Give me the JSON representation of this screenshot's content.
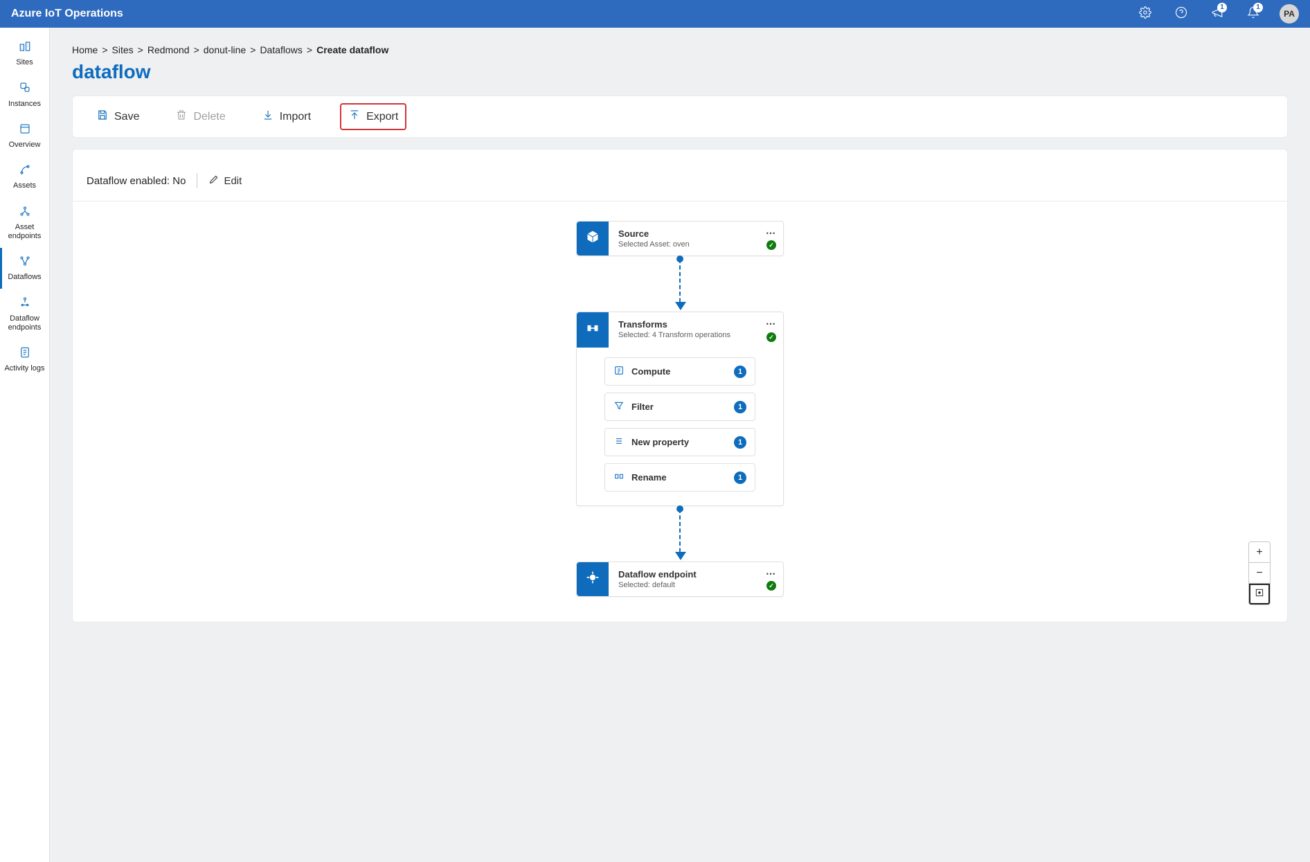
{
  "header": {
    "product_name": "Azure IoT Operations",
    "feedback_badge": "1",
    "bell_badge": "1",
    "avatar_initials": "PA"
  },
  "sidebar": {
    "items": [
      {
        "label": "Sites"
      },
      {
        "label": "Instances"
      },
      {
        "label": "Overview"
      },
      {
        "label": "Assets"
      },
      {
        "label": "Asset endpoints"
      },
      {
        "label": "Dataflows"
      },
      {
        "label": "Dataflow endpoints"
      },
      {
        "label": "Activity logs"
      }
    ]
  },
  "breadcrumb": {
    "items": [
      "Home",
      "Sites",
      "Redmond",
      "donut-line",
      "Dataflows"
    ],
    "current": "Create dataflow"
  },
  "page": {
    "title": "dataflow"
  },
  "toolbar": {
    "save": "Save",
    "delete": "Delete",
    "import": "Import",
    "export": "Export"
  },
  "status": {
    "enabled_label": "Dataflow enabled:",
    "enabled_value": "No",
    "edit_label": "Edit"
  },
  "flow": {
    "source": {
      "title": "Source",
      "subtitle": "Selected Asset: oven"
    },
    "transforms": {
      "title": "Transforms",
      "subtitle": "Selected: 4 Transform operations",
      "ops": [
        {
          "label": "Compute",
          "count": "1"
        },
        {
          "label": "Filter",
          "count": "1"
        },
        {
          "label": "New property",
          "count": "1"
        },
        {
          "label": "Rename",
          "count": "1"
        }
      ]
    },
    "endpoint": {
      "title": "Dataflow endpoint",
      "subtitle": "Selected: default"
    }
  }
}
